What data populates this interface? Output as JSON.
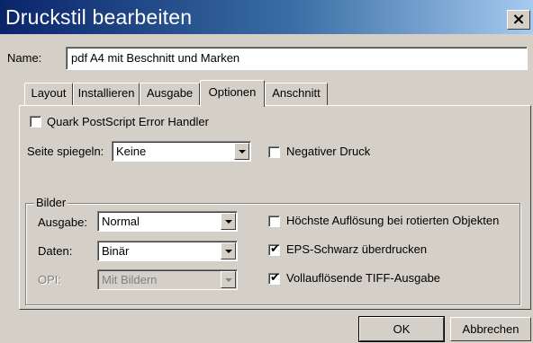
{
  "window": {
    "title": "Druckstil bearbeiten",
    "close_glyph": "×"
  },
  "name_field": {
    "label": "Name:",
    "value": "pdf A4 mit Beschnitt und Marken"
  },
  "tabs": [
    {
      "label": "Layout",
      "active": false
    },
    {
      "label": "Installieren",
      "active": false
    },
    {
      "label": "Ausgabe",
      "active": false
    },
    {
      "label": "Optionen",
      "active": true
    },
    {
      "label": "Anschnitt",
      "active": false
    }
  ],
  "options": {
    "error_handler": {
      "label": "Quark PostScript Error Handler",
      "checked": false
    },
    "mirror": {
      "label": "Seite spiegeln:",
      "value": "Keine"
    },
    "negative": {
      "label": "Negativer Druck",
      "checked": false
    }
  },
  "images_group": {
    "title": "Bilder",
    "output": {
      "label": "Ausgabe:",
      "value": "Normal"
    },
    "data": {
      "label": "Daten:",
      "value": "Binär"
    },
    "opi": {
      "label": "OPI:",
      "value": "Mit Bildern",
      "disabled": true
    },
    "highest_resolution": {
      "label": "Höchste Auflösung bei rotierten Objekten",
      "checked": false
    },
    "eps_black": {
      "label": "EPS-Schwarz überdrucken",
      "checked": true
    },
    "full_res_tiff": {
      "label": "Vollauflösende TIFF-Ausgabe",
      "checked": true
    }
  },
  "buttons": {
    "ok": "OK",
    "cancel": "Abbrechen"
  },
  "check_glyph": "✔"
}
